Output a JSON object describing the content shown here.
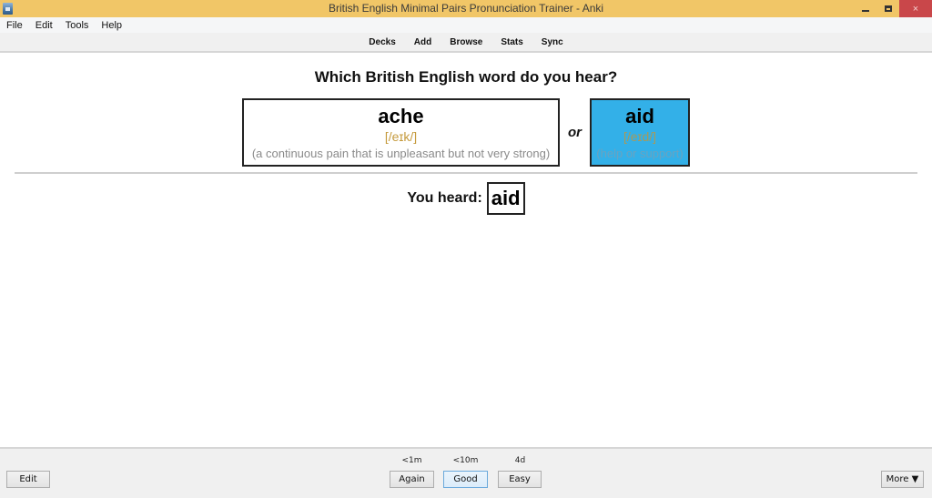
{
  "window": {
    "title": "British English Minimal Pairs Pronunciation Trainer - Anki",
    "app_icon": "anki-app-icon",
    "controls": {
      "minimize": "minimize-icon",
      "maximize": "restore-icon",
      "close_glyph": "×"
    }
  },
  "menubar": {
    "items": [
      "File",
      "Edit",
      "Tools",
      "Help"
    ]
  },
  "toolbar": {
    "items": [
      "Decks",
      "Add",
      "Browse",
      "Stats",
      "Sync"
    ]
  },
  "card": {
    "question": "Which British English word do you hear?",
    "options": [
      {
        "word": "ache",
        "ipa": "[/eɪk/]",
        "definition": "(a continuous pain that is unpleasant but not very strong)",
        "highlighted": false
      },
      {
        "word": "aid",
        "ipa": "[/eɪd/]",
        "definition": "(help or support)",
        "highlighted": true,
        "highlight_color": "#33b0e8"
      }
    ],
    "separator": "or",
    "answer_label": "You heard:",
    "answer_word": "aid"
  },
  "bottombar": {
    "edit_label": "Edit",
    "more_label": "More ▼",
    "answers": [
      {
        "label": "Again",
        "interval": "<1m"
      },
      {
        "label": "Good",
        "interval": "<10m",
        "default": true
      },
      {
        "label": "Easy",
        "interval": "4d"
      }
    ]
  },
  "colors": {
    "titlebar": "#f1c667",
    "close_button": "#c9474a",
    "ipa": "#c59a3c"
  }
}
